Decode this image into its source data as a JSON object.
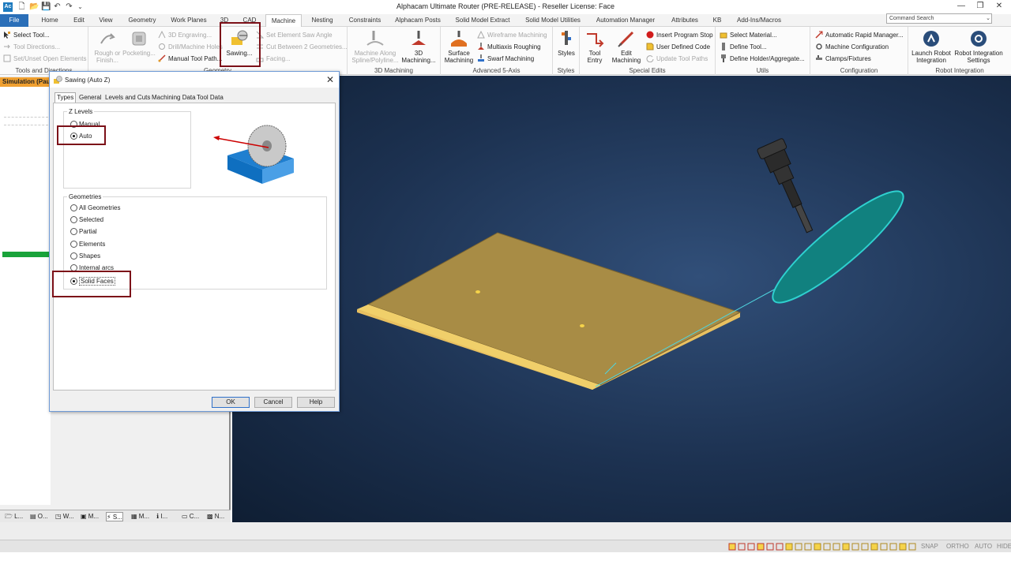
{
  "titlebar": {
    "app_icon": "Ac",
    "title": "Alphacam Ultimate Router (PRE-RELEASE) - Reseller License: Face",
    "qat_icons": [
      "new-file-icon",
      "open-folder-icon",
      "save-icon",
      "undo-icon",
      "redo-icon",
      "qat-dropdown-icon"
    ],
    "qat_glyphs": [
      "🗋",
      "📂",
      "💾",
      "↶",
      "↷",
      "⌄"
    ],
    "min": "—",
    "max": "❐",
    "close": "✕"
  },
  "tabs": [
    "File",
    "Home",
    "Edit",
    "View",
    "Geometry",
    "Work Planes",
    "3D",
    "CAD",
    "Machine",
    "Nesting",
    "Constraints",
    "Alphacam Posts",
    "Solid Model Extract",
    "Solid Model Utilities",
    "Automation Manager",
    "Attributes",
    "KB",
    "Add-Ins/Macros"
  ],
  "active_tab": "Machine",
  "command_search": "Command Search",
  "ribbon": {
    "tools_directions": {
      "label": "Tools and Directions",
      "select_tool": "Select Tool...",
      "tool_directions": "Tool Directions...",
      "set_unset_open": "Set/Unset Open Elements"
    },
    "geometry": {
      "label": "Geometry",
      "rough_finish": "Rough or\nFinish...",
      "pocketing": "Pocketing...",
      "engraving_3d": "3D Engraving...",
      "drill_holes": "Drill/Machine Holes",
      "manual_tool_path": "Manual Tool Path...",
      "sawing": "Sawing...",
      "set_saw_angle": "Set Element Saw Angle",
      "cut_between": "Cut Between 2 Geometries...",
      "facing": "Facing..."
    },
    "machining_3d": {
      "label": "3D Machining",
      "machine_along": "Machine Along\nSpline/Polyline...",
      "machining_3d": "3D\nMachining..."
    },
    "adv5": {
      "label": "Advanced 5-Axis",
      "surface": "Surface\nMachining",
      "wireframe": "Wireframe Machining",
      "multiaxis": "Multiaxis Roughing",
      "swarf": "Swarf Machining"
    },
    "styles": {
      "label": "Styles",
      "styles": "Styles"
    },
    "special": {
      "label": "Special Edits",
      "tool_entry": "Tool\nEntry",
      "edit_machining": "Edit\nMachining",
      "insert_stop": "Insert Program Stop",
      "user_code": "User Defined Code",
      "update_paths": "Update Tool Paths"
    },
    "utils": {
      "label": "Utils",
      "select_material": "Select Material...",
      "define_tool": "Define Tool...",
      "define_holder": "Define Holder/Aggregate..."
    },
    "config": {
      "label": "Configuration",
      "rapid_manager": "Automatic Rapid Manager...",
      "machine_config": "Machine Configuration",
      "clamps": "Clamps/Fixtures"
    },
    "robot": {
      "label": "Robot Integration",
      "launch": "Launch Robot\nIntegration",
      "settings": "Robot Integration\nSettings"
    }
  },
  "left_panel": {
    "header": "Simulation (Paused)",
    "tabs": [
      "L...",
      "O...",
      "W...",
      "M...",
      "S...",
      "M...",
      "I...",
      "C...",
      "N..."
    ],
    "tab_icons": [
      "layers-icon",
      "operations-icon",
      "workplanes-icon",
      "machining-icon",
      "sawing-icon",
      "materials-icon",
      "info-icon",
      "clamps-icon",
      "nesting-icon"
    ],
    "tab_glyphs": [
      "🗁",
      "▤",
      "◳",
      "▣",
      "⚡",
      "▦",
      "ℹ",
      "▭",
      "▩"
    ],
    "active_tab_index": 4
  },
  "status_bar": {
    "items": [
      "SNAP",
      "ORTHO",
      "AUTO",
      "HIDE"
    ],
    "icon_names": [
      "grid-icon",
      "grid-icon",
      "grid-icon",
      "axis-icon",
      "axis-icon",
      "axis-icon",
      "view-icon",
      "view-icon",
      "view-icon",
      "view-icon",
      "view-icon",
      "view-icon",
      "view-icon",
      "view-icon",
      "view-icon",
      "view-icon",
      "view-icon",
      "view-icon",
      "view-icon",
      "view-icon"
    ]
  },
  "dialog": {
    "title": "Sawing (Auto Z)",
    "close": "✕",
    "tabs": [
      "Types",
      "General",
      "Levels and Cuts",
      "Machining Data",
      "Tool Data"
    ],
    "active_tab": "Types",
    "z_levels": {
      "label": "Z Levels",
      "options": [
        "Manual",
        "Auto"
      ],
      "selected": "Auto"
    },
    "geometries": {
      "label": "Geometries",
      "options": [
        "All Geometries",
        "Selected",
        "Partial",
        "Elements",
        "Shapes",
        "Internal arcs",
        "Solid Faces"
      ],
      "selected": "Solid Faces"
    },
    "buttons": {
      "ok": "OK",
      "cancel": "Cancel",
      "help": "Help"
    }
  },
  "colors": {
    "accent": "#2b6fb8",
    "highlight": "#7c1018",
    "sim_header": "#f0a030",
    "green": "#19a33a",
    "viewport_bg": "#1c3150",
    "panel_face": "#a88c45",
    "saw_disc": "#11817f"
  }
}
